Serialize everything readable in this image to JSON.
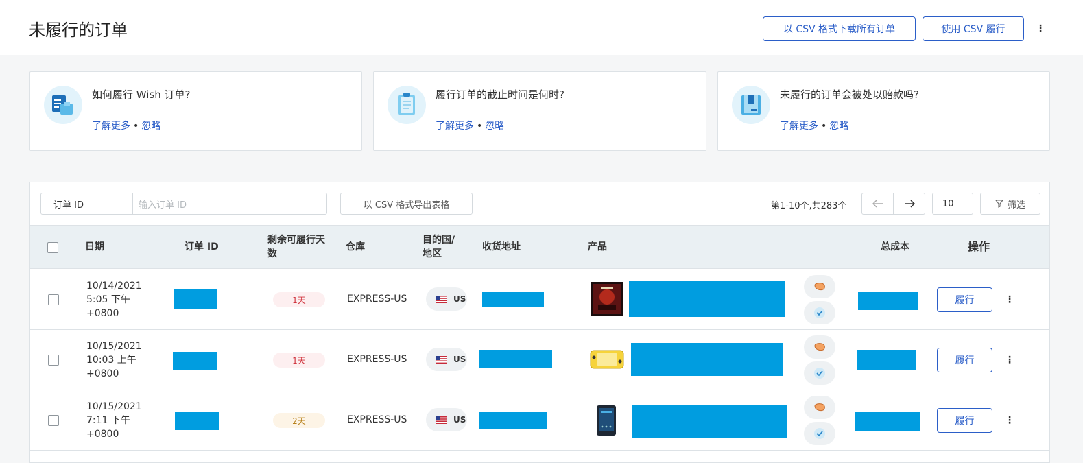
{
  "header": {
    "title": "未履行的订单",
    "download_csv_label": "以 CSV 格式下载所有订单",
    "fulfill_csv_label": "使用 CSV 履行",
    "more_icon": "vertical-ellipsis-icon"
  },
  "cards": [
    {
      "question": "如何履行 Wish 订单?",
      "learn_more": "了解更多",
      "separator": "•",
      "ignore": "忽略",
      "icon": "order-documents-icon"
    },
    {
      "question": "履行订单的截止时间是何时?",
      "learn_more": "了解更多",
      "separator": "•",
      "ignore": "忽略",
      "icon": "clipboard-icon"
    },
    {
      "question": "未履行的订单会被处以赔款吗?",
      "learn_more": "了解更多",
      "separator": "•",
      "ignore": "忽略",
      "icon": "package-icon"
    }
  ],
  "toolbar": {
    "filter_select": "订单 ID",
    "filter_placeholder": "输入订单 ID",
    "export_label": "以 CSV 格式导出表格",
    "page_info": "第1-10个,共283个",
    "prev_icon": "arrow-left-icon",
    "next_icon": "arrow-right-icon",
    "page_size": "10",
    "filter_label": "筛选"
  },
  "table": {
    "columns": {
      "date": "日期",
      "order_id": "订单 ID",
      "days_left": "剩余可履行天数",
      "warehouse": "仓库",
      "destination": "目的国/地区",
      "address": "收货地址",
      "product": "产品",
      "total_cost": "总成本",
      "actions": "操作"
    },
    "rows": [
      {
        "date_line1": "10/14/2021",
        "date_line2": "5:05 下午",
        "date_line3": "+0800",
        "days": "1天",
        "days_status": "urgent",
        "warehouse": "EXPRESS-US",
        "country": "US",
        "product_thumb": "movie-poster",
        "action": "履行"
      },
      {
        "date_line1": "10/15/2021",
        "date_line2": "10:03 上午",
        "date_line3": "+0800",
        "days": "1天",
        "days_status": "urgent",
        "warehouse": "EXPRESS-US",
        "country": "US",
        "product_thumb": "yellow-game-console",
        "action": "履行"
      },
      {
        "date_line1": "10/15/2021",
        "date_line2": "7:11 下午",
        "date_line3": "+0800",
        "days": "2天",
        "days_status": "warning",
        "warehouse": "EXPRESS-US",
        "country": "US",
        "product_thumb": "dark-tablet",
        "action": "履行"
      }
    ]
  },
  "colors": {
    "accent": "#2b5ec8",
    "redaction": "#009de0",
    "urgent_text": "#d0343e",
    "warning_text": "#b7801a",
    "header_bg": "#eaf0f3"
  }
}
